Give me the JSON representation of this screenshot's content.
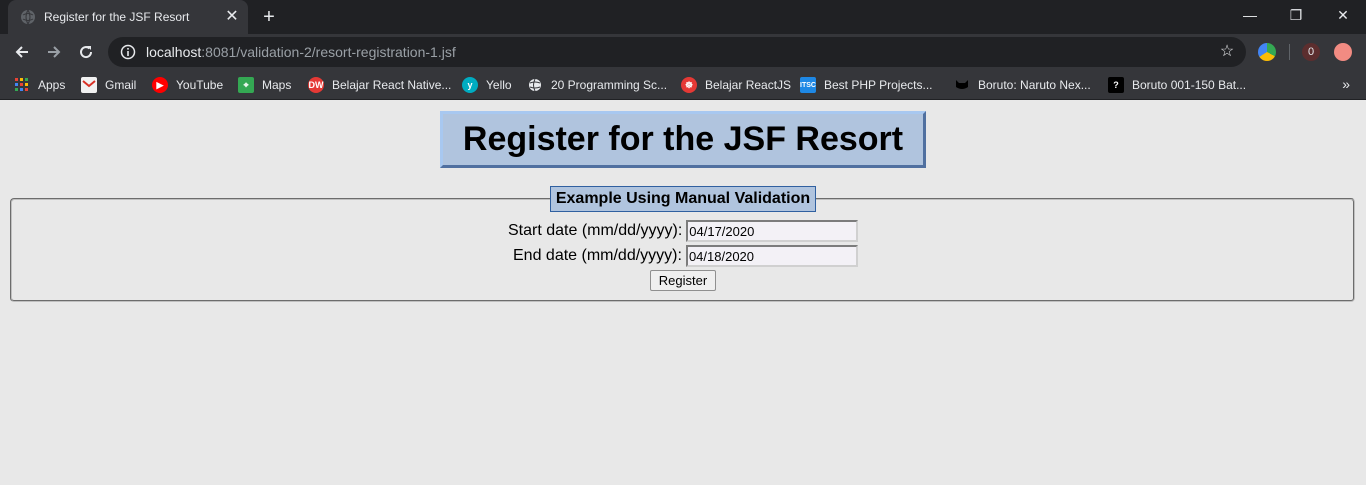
{
  "browser": {
    "tab_title": "Register for the JSF Resort",
    "tab_close": "✕",
    "new_tab": "+",
    "url_host": "localhost",
    "url_path": ":8081/validation-2/resort-registration-1.jsf",
    "extension_badge": "0",
    "window_controls": {
      "minimize": "—",
      "restore": "❐",
      "close": "✕"
    }
  },
  "bookmarks": [
    {
      "label": "Apps",
      "icon": "apps-icon",
      "color": "#ea4335"
    },
    {
      "label": "Gmail",
      "icon": "gmail-icon",
      "color": "#d93025"
    },
    {
      "label": "YouTube",
      "icon": "youtube-icon",
      "color": "#ff0000"
    },
    {
      "label": "Maps",
      "icon": "maps-icon",
      "color": "#34a853"
    },
    {
      "label": "Belajar React Native...",
      "icon": "dw-icon",
      "color": "#e53935"
    },
    {
      "label": "Yello",
      "icon": "yello-icon",
      "color": "#00acc1"
    },
    {
      "label": "20 Programming Sc...",
      "icon": "globe-icon",
      "color": "#e8eaed"
    },
    {
      "label": "Belajar ReactJS",
      "icon": "react-icon",
      "color": "#e53935"
    },
    {
      "label": "Best PHP Projects...",
      "icon": "itsc-icon",
      "color": "#1e88e5"
    },
    {
      "label": "Boruto: Naruto Nex...",
      "icon": "cat-icon",
      "color": "#202124"
    },
    {
      "label": "Boruto 001-150 Bat...",
      "icon": "question-icon",
      "color": "#000000"
    }
  ],
  "bookmarks_more": "»",
  "page": {
    "title": "Register for the JSF Resort",
    "legend": "Example Using Manual Validation",
    "start_label": "Start date (mm/dd/yyyy):",
    "start_value": "04/17/2020",
    "end_label": "End date (mm/dd/yyyy):",
    "end_value": "04/18/2020",
    "submit_label": "Register"
  }
}
